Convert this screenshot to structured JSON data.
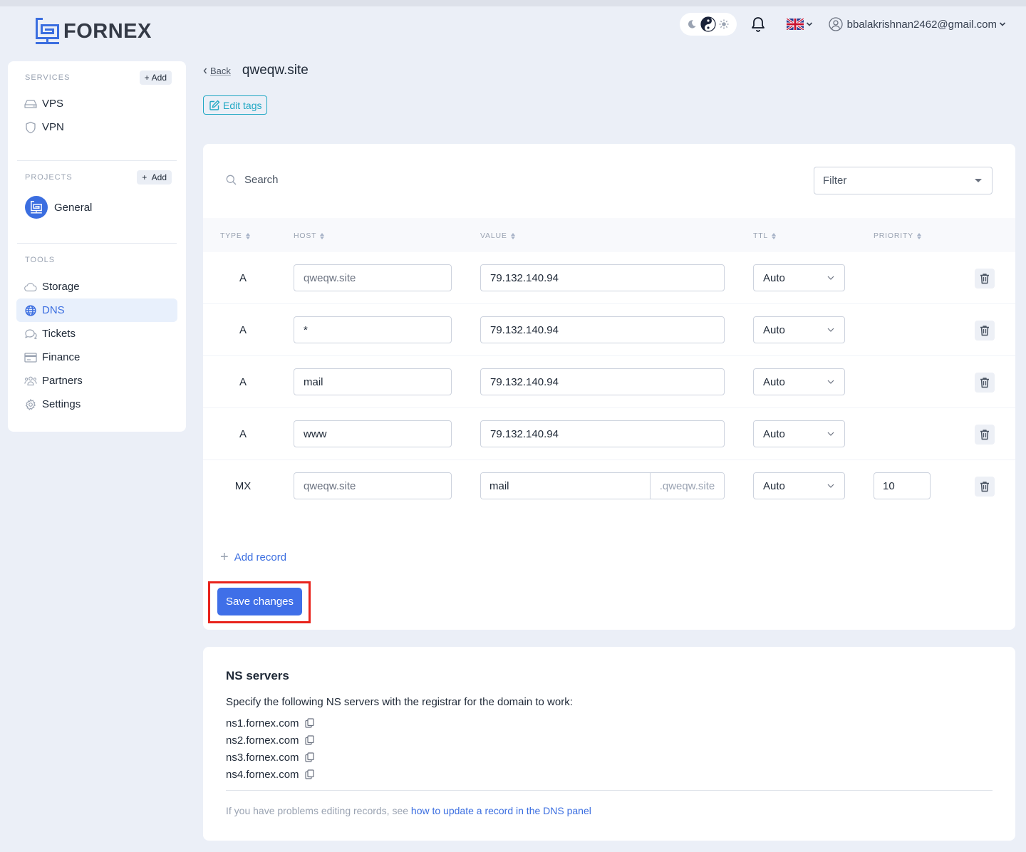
{
  "brand": {
    "name": "FORNEX",
    "accent": "#3b6ee0"
  },
  "header": {
    "theme_options": [
      "moon-icon",
      "yin-yang-icon",
      "sun-icon"
    ],
    "notifications_icon": "bell-icon",
    "language_icon": "uk-flag-icon",
    "user_email": "bbalakrishnan2462@gmail.com"
  },
  "sidebar": {
    "services_label": "SERVICES",
    "services_add": "Add",
    "services": [
      {
        "label": "VPS",
        "icon": "server-icon"
      },
      {
        "label": "VPN",
        "icon": "shield-icon"
      }
    ],
    "projects_label": "PROJECTS",
    "projects_add": "Add",
    "projects": [
      {
        "label": "General",
        "icon": "project-logo-icon"
      }
    ],
    "tools_label": "TOOLS",
    "tools": [
      {
        "label": "Storage",
        "icon": "cloud-icon",
        "active": false
      },
      {
        "label": "DNS",
        "icon": "globe-icon",
        "active": true
      },
      {
        "label": "Tickets",
        "icon": "chat-icon",
        "active": false
      },
      {
        "label": "Finance",
        "icon": "credit-card-icon",
        "active": false
      },
      {
        "label": "Partners",
        "icon": "users-icon",
        "active": false
      },
      {
        "label": "Settings",
        "icon": "gear-icon",
        "active": false
      }
    ]
  },
  "page": {
    "back_label": "Back",
    "title": "qweqw.site",
    "edit_tags_label": "Edit tags"
  },
  "records": {
    "search_placeholder": "Search",
    "filter_placeholder": "Filter",
    "columns": [
      "TYPE",
      "HOST",
      "VALUE",
      "TTL",
      "PRIORITY"
    ],
    "rows": [
      {
        "type": "A",
        "host": "",
        "host_placeholder": "qweqw.site",
        "value": "79.132.140.94",
        "ttl": "Auto"
      },
      {
        "type": "A",
        "host": "*",
        "host_placeholder": "",
        "value": "79.132.140.94",
        "ttl": "Auto"
      },
      {
        "type": "A",
        "host": "mail",
        "host_placeholder": "",
        "value": "79.132.140.94",
        "ttl": "Auto"
      },
      {
        "type": "A",
        "host": "www",
        "host_placeholder": "",
        "value": "79.132.140.94",
        "ttl": "Auto"
      },
      {
        "type": "MX",
        "host": "",
        "host_placeholder": "qweqw.site",
        "value": "mail",
        "value_suffix": ".qweqw.site",
        "ttl": "Auto",
        "priority": "10"
      }
    ],
    "add_record_label": "Add record",
    "save_label": "Save changes"
  },
  "ns": {
    "title": "NS servers",
    "description": "Specify the following NS servers with the registrar for the domain to work:",
    "servers": [
      "ns1.fornex.com",
      "ns2.fornex.com",
      "ns3.fornex.com",
      "ns4.fornex.com"
    ],
    "help_text": "If you have problems editing records, see ",
    "help_link": "how to update a record in the DNS panel"
  }
}
